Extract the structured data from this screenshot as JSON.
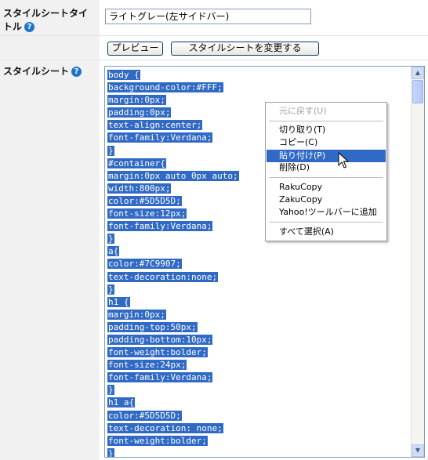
{
  "form": {
    "title_row": {
      "label": "スタイルシートタイトル",
      "input_value": "ライトグレー(左サイドバー)"
    },
    "buttons": {
      "preview": "プレビュー",
      "change": "スタイルシートを変更する"
    },
    "stylesheet_row": {
      "label": "スタイルシート"
    }
  },
  "help_icon": {
    "glyph": "?"
  },
  "stylesheet_code": [
    "body {",
    "background-color:#FFF;",
    "margin:0px;",
    "padding:0px;",
    "text-align:center;",
    "font-family:Verdana;",
    "}",
    "#container{",
    "margin:0px auto 0px auto;",
    "width:800px;",
    "color:#5D5D5D;",
    "font-size:12px;",
    "font-family:Verdana;",
    "}",
    "a{",
    "color:#7C9907;",
    "text-decoration:none;",
    "}",
    "h1 {",
    "margin:0px;",
    "padding-top:50px;",
    "padding-bottom:10px;",
    "font-weight:bolder;",
    "font-size:24px;",
    "font-family:Verdana;",
    "}",
    "h1 a{",
    "color:#5D5D5D;",
    "text-decoration: none;",
    "font-weight:bolder;",
    "}"
  ],
  "context_menu": {
    "undo": "元に戻す(U)",
    "cut": "切り取り(T)",
    "copy": "コピー(C)",
    "paste": "貼り付け(P)",
    "delete": "削除(D)",
    "rakucopy": "RakuCopy",
    "zakucopy": "ZakuCopy",
    "yahoo_toolbar": "Yahoo!ツールバーに追加",
    "select_all": "すべて選択(A)"
  },
  "colors": {
    "selection": "#316ac5",
    "label_background": "#f1f1f1",
    "help_icon": "#1e74c8"
  }
}
